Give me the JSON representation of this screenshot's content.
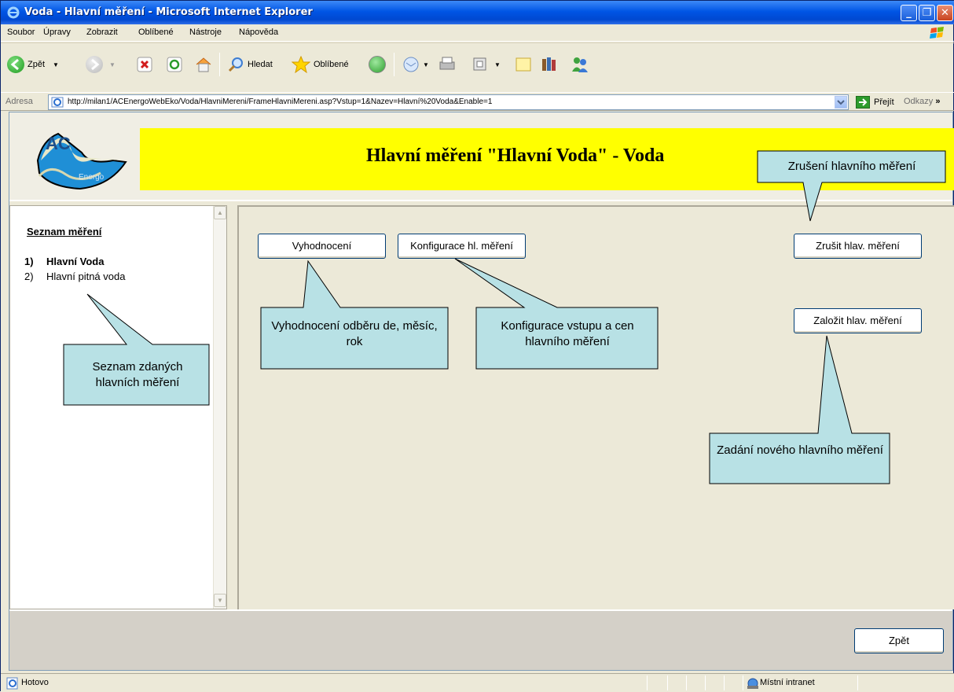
{
  "window": {
    "title": "Voda - Hlavní měření - Microsoft Internet Explorer",
    "controls": [
      "minimize",
      "maximize",
      "close"
    ]
  },
  "menu": [
    "Soubor",
    "Úpravy",
    "Zobrazit",
    "Oblíbené",
    "Nástroje",
    "Nápověda"
  ],
  "toolbar": {
    "back": "Zpět",
    "search": "Hledat",
    "favorites": "Oblíbené"
  },
  "address": {
    "label": "Adresa",
    "url": "http://milan1/ACEnergoWebEko/Voda/HlavniMereni/FrameHlavniMereni.asp?Vstup=1&Nazev=Hlavní%20Voda&Enable=1",
    "go": "Přejít",
    "links": "Odkazy",
    "more": "»"
  },
  "header": {
    "logo_text": "AC",
    "logo_subtext": "Energo",
    "title": "Hlavní měření \"Hlavní Voda\" - Voda"
  },
  "left": {
    "title": "Seznam měření",
    "items": [
      {
        "num": "1)",
        "label": "Hlavní Voda",
        "selected": true
      },
      {
        "num": "2)",
        "label": "Hlavní pitná voda",
        "selected": false
      }
    ]
  },
  "buttons": {
    "evaluate": "Vyhodnocení",
    "config": "Konfigurace hl. měření",
    "cancel": "Zrušit hlav. měření",
    "create": "Založit hlav. měření",
    "back": "Zpět"
  },
  "callouts": {
    "cancel": "Zrušení hlavního měření",
    "evaluate": "Vyhodnocení odběru de, měsíc, rok",
    "config": "Konfigurace vstupu a cen hlavního měření",
    "list": "Seznam zdaných hlavních měření",
    "create": "Zadání nového hlavního měření"
  },
  "status": {
    "text": "Hotovo",
    "zone": "Místní intranet"
  },
  "colors": {
    "banner": "#ffff00",
    "callout_fill": "#b8e1e5",
    "titlebar": "#0055e5"
  }
}
